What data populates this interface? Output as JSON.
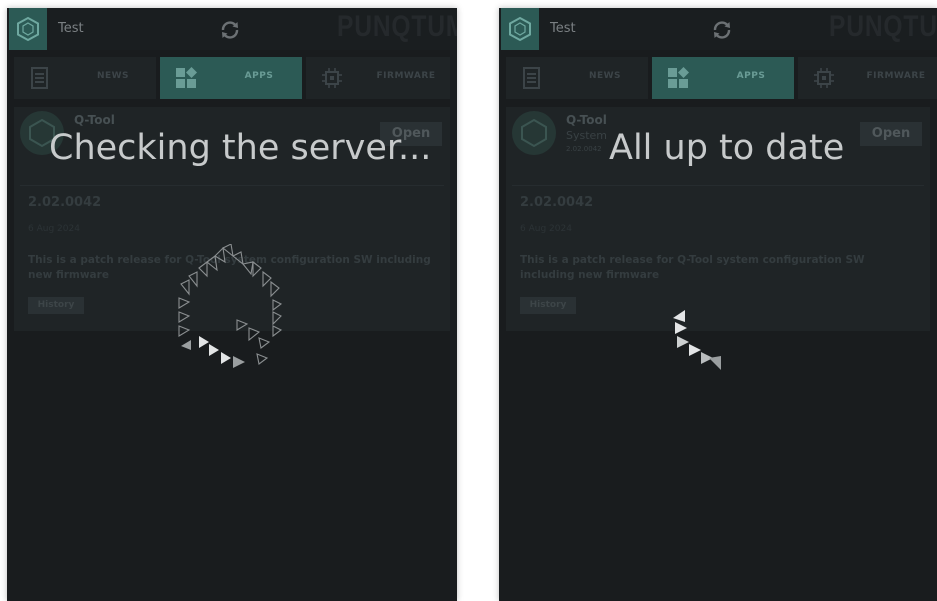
{
  "panels": [
    {
      "topbar": {
        "title": "Test",
        "brand": "PUNQTUM"
      },
      "tabs": [
        {
          "label": "NEWS",
          "icon": "news-icon",
          "active": false
        },
        {
          "label": "APPS",
          "icon": "apps-icon",
          "active": true
        },
        {
          "label": "FIRMWARE",
          "icon": "chip-icon",
          "active": false
        }
      ],
      "app": {
        "name": "Q-Tool",
        "subtitle": "System",
        "version_small": "2.02.0042",
        "open_label": "Open",
        "version": "2.02.0042",
        "date": "6 Aug 2024",
        "notes": "This is a patch release for Q-Tool system configuration SW including new firmware",
        "history_label": "History"
      },
      "status_message": "Checking the server..."
    },
    {
      "topbar": {
        "title": "Test",
        "brand": "PUNQTUM"
      },
      "tabs": [
        {
          "label": "NEWS",
          "icon": "news-icon",
          "active": false
        },
        {
          "label": "APPS",
          "icon": "apps-icon",
          "active": true
        },
        {
          "label": "FIRMWARE",
          "icon": "chip-icon",
          "active": false
        }
      ],
      "app": {
        "name": "Q-Tool",
        "subtitle": "System",
        "version_small": "2.02.0042",
        "open_label": "Open",
        "version": "2.02.0042",
        "date": "6 Aug 2024",
        "notes": "This is a patch release for Q-Tool system configuration SW including new firmware",
        "history_label": "History"
      },
      "status_message": "All up to date"
    }
  ],
  "colors": {
    "accent": "#2c5a55",
    "background": "#191c1e",
    "overlay_text": "#c7cacb"
  }
}
